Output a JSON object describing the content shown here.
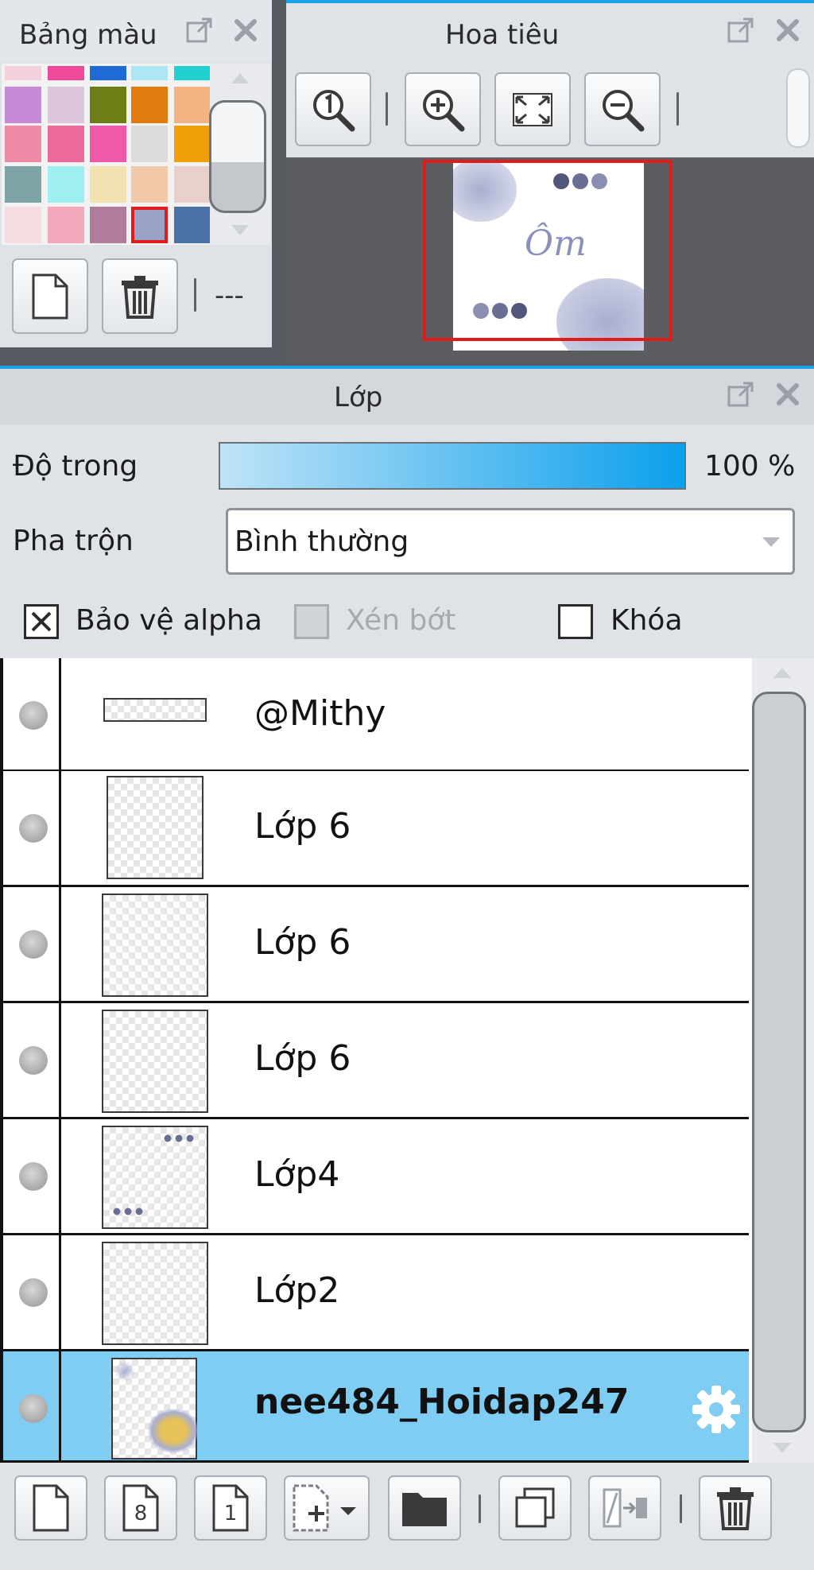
{
  "palette": {
    "title": "Bảng màu",
    "dash_text": "---",
    "swatches": [
      [
        "#f4cfdc",
        "#ee4a9a",
        "#1f6bd6",
        "#aee6f4",
        "#22cfcf"
      ],
      [
        "#c68bd6",
        "#dcc7da",
        "#6e7d16",
        "#e07b0e",
        "#f2b483"
      ],
      [
        "#ee8aa6",
        "#ec6a9b",
        "#ee5aa8",
        "#dcdcdc",
        "#f2a00a"
      ],
      [
        "#7ea4a8",
        "#9ef0f0",
        "#efe1b0",
        "#f2c9a8",
        "#ead0cc"
      ],
      [
        "#f5dce0",
        "#f4a8bb",
        "#b07b9d",
        "#9aa3c7",
        "#4a72a8"
      ]
    ],
    "selected_color": "#9aa3c7"
  },
  "navigator": {
    "title": "Hoa tiêu",
    "preview_text": "Ôm"
  },
  "layers_panel": {
    "title": "Lớp",
    "opacity_label": "Độ trong",
    "opacity_value": "100 %",
    "opacity_fraction": 1.0,
    "blend_label": "Pha trộn",
    "blend_value": "Bình thường",
    "protect_alpha_label": "Bảo vệ alpha",
    "clipping_label": "Xén bớt",
    "lock_label": "Khóa",
    "layers": [
      {
        "name": "@Mithy"
      },
      {
        "name": "Lớp 6"
      },
      {
        "name": "Lớp 6"
      },
      {
        "name": "Lớp 6"
      },
      {
        "name": "Lớp4"
      },
      {
        "name": "Lớp2"
      },
      {
        "name": "nee484_Hoidap247",
        "selected": true
      }
    ],
    "new_8bit_label": "8",
    "new_1bit_label": "1"
  },
  "colors": {
    "accent": "#1aa3ea",
    "selected_row": "#7fcdf3",
    "nav_frame": "#e21a1a"
  }
}
